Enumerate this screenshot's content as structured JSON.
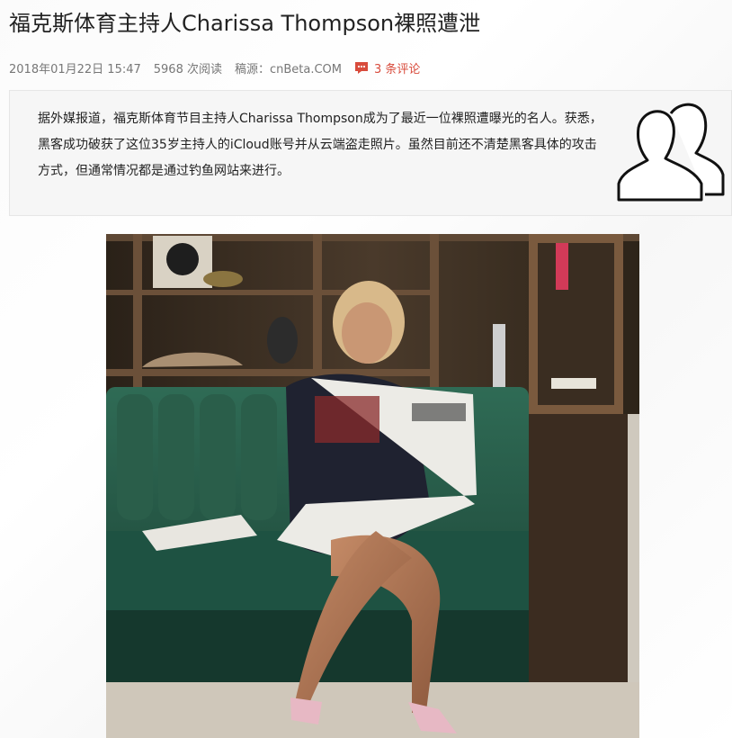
{
  "article": {
    "title": "福克斯体育主持人Charissa Thompson裸照遭泄",
    "meta": {
      "datetime": "2018年01月22日 15:47",
      "views": "5968 次阅读",
      "source": "稿源：cnBeta.COM",
      "comments": "3 条评论"
    },
    "summary": "据外媒报道，福克斯体育节目主持人Charissa Thompson成为了最近一位裸照遭曝光的名人。获悉，黑客成功破获了这位35岁主持人的iCloud账号并从云端盗走照片。虽然目前还不清楚黑客具体的攻击方式，但通常情况都是通过钓鱼网站来进行。",
    "icons": {
      "comment": "comment-icon",
      "summary": "users-icon"
    },
    "colors": {
      "accent": "#d84b3c",
      "meta_text": "#777777",
      "summary_bg": "#f6f6f6"
    }
  }
}
